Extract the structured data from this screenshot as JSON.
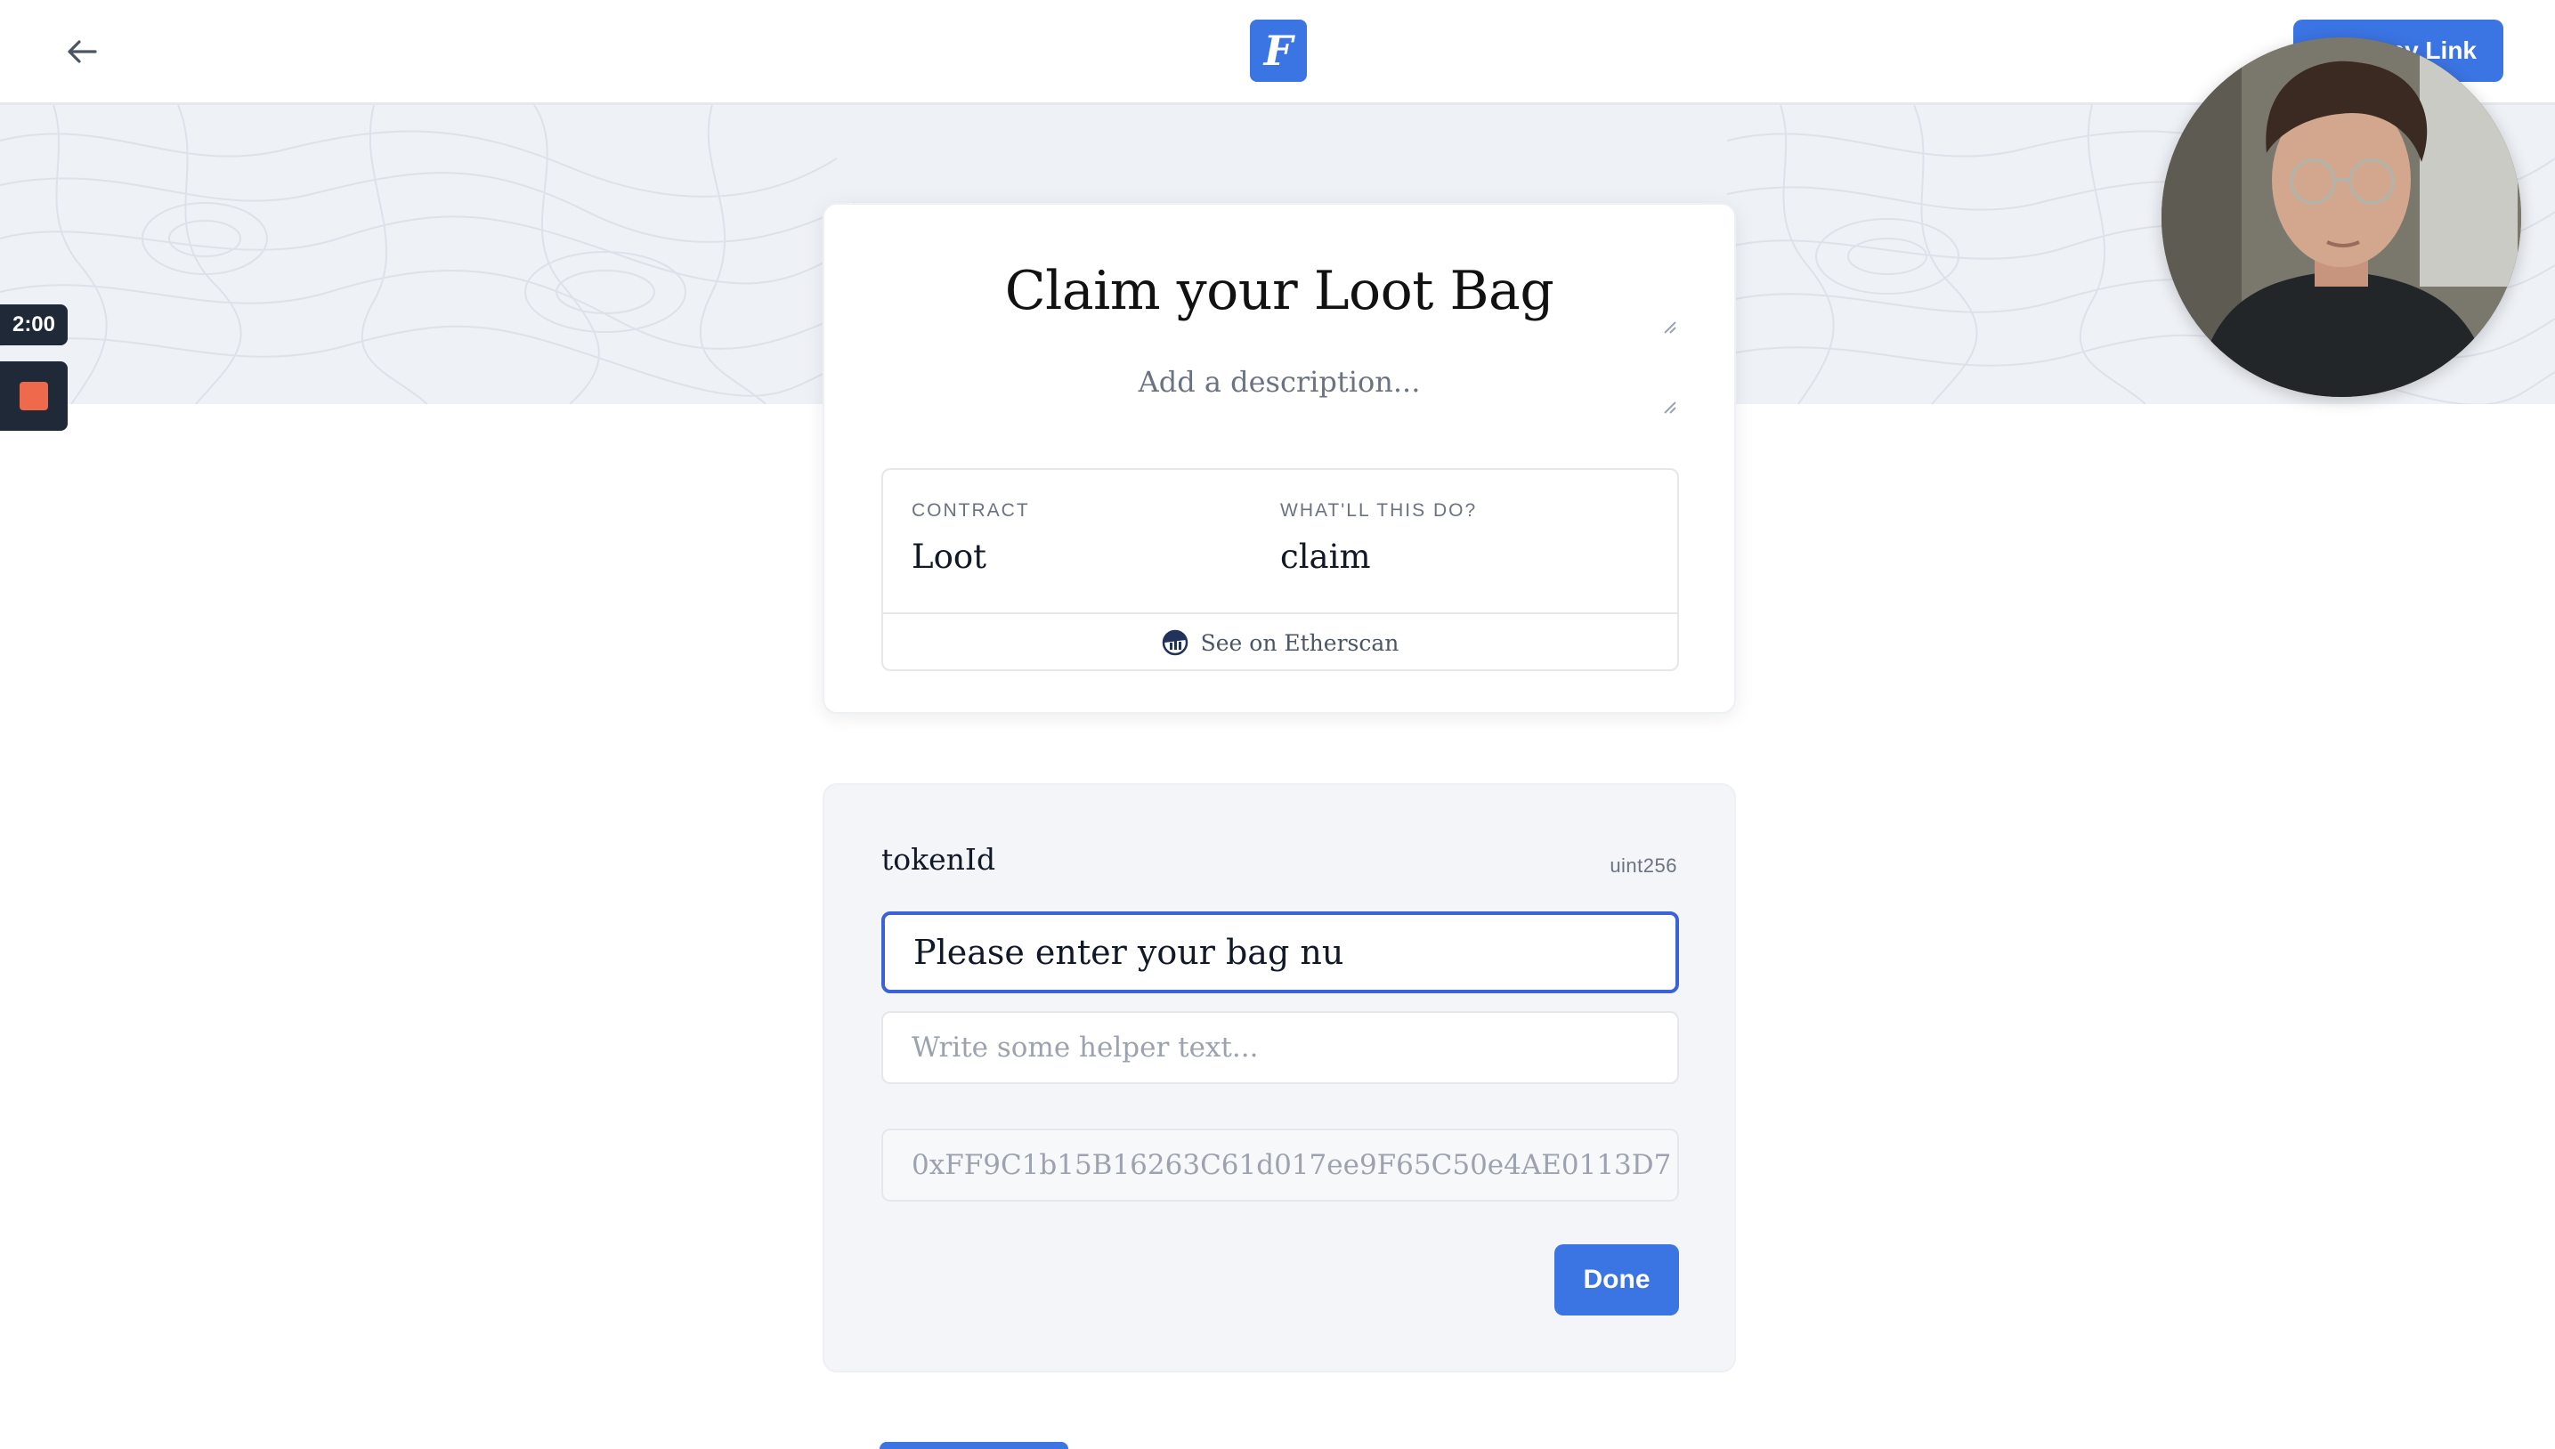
{
  "topbar": {
    "back_icon": "arrow-left-icon",
    "logo_letter": "F",
    "copy_link_label": "Copy Link"
  },
  "recorder": {
    "timer": "2:00",
    "stop_icon": "stop-square-icon",
    "stop_color": "#ef6a4c"
  },
  "header_card": {
    "title": "Claim your Loot Bag",
    "description_placeholder": "Add a description...",
    "contract_label": "CONTRACT",
    "contract_value": "Loot",
    "action_label": "WHAT'LL THIS DO?",
    "action_value": "claim",
    "etherscan_label": "See on Etherscan"
  },
  "param_card": {
    "name": "tokenId",
    "type": "uint256",
    "placeholder_value": "Please enter your bag nu",
    "helper_placeholder": "Write some helper text...",
    "contract_address": "0xFF9C1b15B16263C61d017ee9F65C50e4AE0113D7",
    "done_label": "Done"
  },
  "colors": {
    "accent": "#3b74e3",
    "banner": "#eef1f6",
    "focus_border": "#3b63d8"
  }
}
